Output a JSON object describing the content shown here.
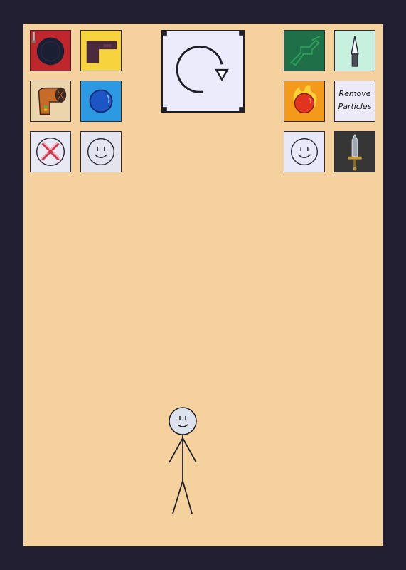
{
  "game": {
    "background_color": "#f5d19e",
    "frame_color": "#221f33",
    "reset_button": {
      "icon": "rotate-icon"
    },
    "left_tools": [
      {
        "icon": "record-disc-icon",
        "bg": "#c0272d"
      },
      {
        "icon": "pistol-icon",
        "bg": "#f7d33e"
      },
      {
        "icon": "cannon-icon",
        "bg": "#ecd5ad"
      },
      {
        "icon": "blue-ball-icon",
        "bg": "#2c9ae3"
      },
      {
        "icon": "cross-target-icon",
        "bg": "#e9e9f3"
      },
      {
        "icon": "smiley-face-icon",
        "bg": "#e4e4ee"
      }
    ],
    "right_tools": [
      {
        "icon": "green-gun-icon",
        "bg": "#1f7048"
      },
      {
        "icon": "knife-icon",
        "bg": "#c8f0de"
      },
      {
        "icon": "fire-ball-icon",
        "bg": "#f39a1b"
      },
      {
        "icon": "remove-particles-icon",
        "bg": "#eceaf6",
        "line1": "Remove",
        "line2": "Particles"
      },
      {
        "icon": "smiley-face-icon",
        "bg": "#e8e8f8"
      },
      {
        "icon": "sword-icon",
        "bg": "#363636"
      }
    ],
    "character": {
      "icon": "stick-figure-icon"
    }
  }
}
